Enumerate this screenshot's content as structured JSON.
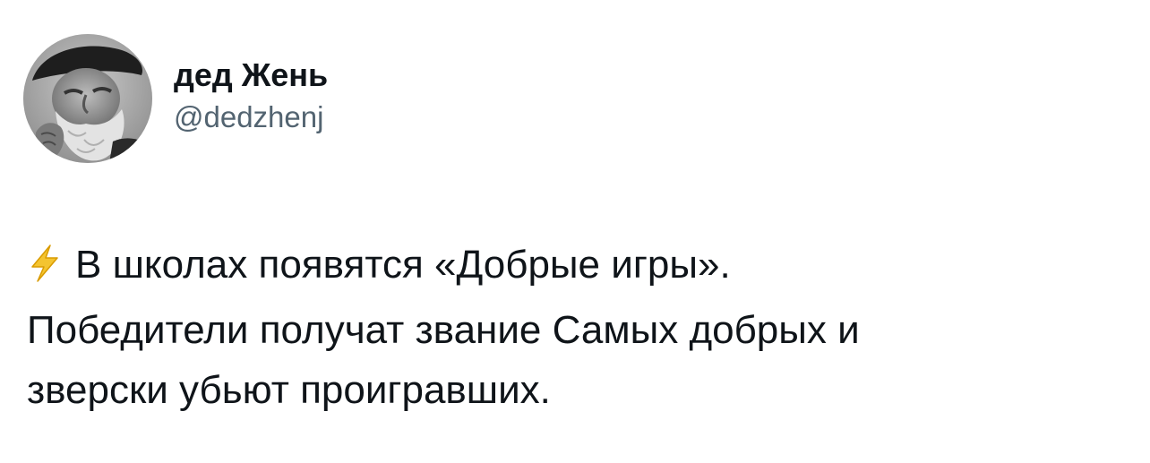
{
  "author": {
    "display_name": "дед Жень",
    "handle": "@dedzhenj",
    "avatar_icon": "bearded-old-man-photo"
  },
  "tweet": {
    "emoji_icon": "lightning-bolt-emoji",
    "text_line_1": "В школах появятся «Добрые игры».",
    "text_line_2": "Победители получат звание Самых добрых и",
    "text_line_3": "зверски убьют проигравших."
  },
  "colors": {
    "text": "#0f1419",
    "secondary_text": "#536471",
    "background": "#ffffff",
    "bolt": "#f4c430"
  }
}
